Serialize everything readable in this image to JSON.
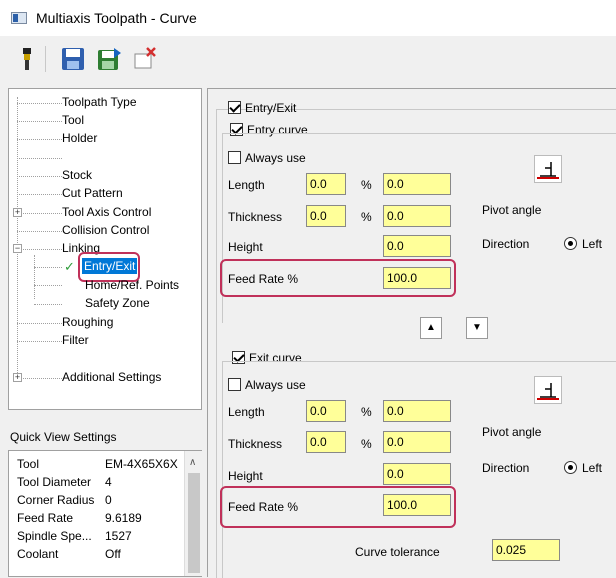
{
  "window": {
    "title": "Multiaxis Toolpath - Curve"
  },
  "toolbar": {
    "icons": [
      "tool-holder-icon",
      "save-icon",
      "save-export-icon",
      "delete-icon"
    ]
  },
  "tree": {
    "items": [
      {
        "label": "Toolpath Type"
      },
      {
        "label": "Tool"
      },
      {
        "label": "Holder"
      },
      {
        "label": "Stock"
      },
      {
        "label": "Cut Pattern"
      },
      {
        "label": "Tool Axis Control"
      },
      {
        "label": "Collision Control"
      },
      {
        "label": "Linking"
      },
      {
        "label": "Entry/Exit"
      },
      {
        "label": "Home/Ref. Points"
      },
      {
        "label": "Safety Zone"
      },
      {
        "label": "Roughing"
      },
      {
        "label": "Filter"
      },
      {
        "label": "Additional Settings"
      }
    ]
  },
  "quickview": {
    "title": "Quick View Settings",
    "rows": [
      {
        "label": "Tool",
        "value": "EM-4X65X6X"
      },
      {
        "label": "Tool Diameter",
        "value": "4"
      },
      {
        "label": "Corner Radius",
        "value": "0"
      },
      {
        "label": "Feed Rate",
        "value": "9.6189"
      },
      {
        "label": "Spindle Spe...",
        "value": "1527"
      },
      {
        "label": "Coolant",
        "value": "Off"
      }
    ]
  },
  "entry_exit": {
    "label": "Entry/Exit",
    "checked": true,
    "entry": {
      "label": "Entry curve",
      "always_use": "Always use",
      "length_label": "Length",
      "length_value": "0.0",
      "length_pct": "0.0",
      "thickness_label": "Thickness",
      "thickness_value": "0.0",
      "thickness_pct": "0.0",
      "height_label": "Height",
      "height_value": "0.0",
      "feed_label": "Feed Rate %",
      "feed_value": "100.0",
      "pivot_label": "Pivot angle",
      "direction_label": "Direction",
      "left_label": "Left",
      "percent": "%"
    },
    "exit": {
      "label": "Exit curve",
      "always_use": "Always use",
      "length_label": "Length",
      "length_value": "0.0",
      "length_pct": "0.0",
      "thickness_label": "Thickness",
      "thickness_value": "0.0",
      "thickness_pct": "0.0",
      "height_label": "Height",
      "height_value": "0.0",
      "feed_label": "Feed Rate %",
      "feed_value": "100.0",
      "pivot_label": "Pivot angle",
      "direction_label": "Direction",
      "left_label": "Left",
      "percent": "%"
    },
    "curve_tolerance_label": "Curve tolerance",
    "curve_tolerance_value": "0.025"
  },
  "colors": {
    "highlight": "#c0315a",
    "input_bg": "#ffff99",
    "selection": "#0078d7"
  }
}
